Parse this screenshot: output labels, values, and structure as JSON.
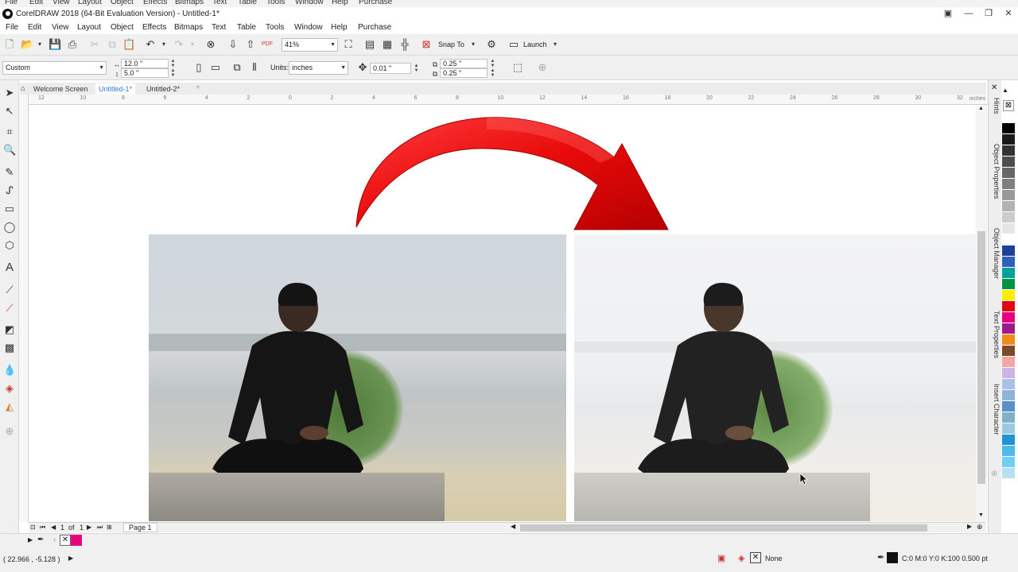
{
  "app": {
    "title": "CorelDRAW 2018 (64-Bit Evaluation Version) - Untitled-1*",
    "ghost_menu": [
      "File",
      "Edit",
      "View",
      "Layout",
      "Object",
      "Effects",
      "Bitmaps",
      "Text",
      "Table",
      "Tools",
      "Window",
      "Help",
      "Purchase"
    ]
  },
  "menubar": [
    "File",
    "Edit",
    "View",
    "Layout",
    "Object",
    "Effects",
    "Bitmaps",
    "Text",
    "Table",
    "Tools",
    "Window",
    "Help",
    "Purchase"
  ],
  "toolbar": {
    "zoom_value": "41%",
    "snap_to_label": "Snap To",
    "launch_label": "Launch",
    "pdf_label": "PDF"
  },
  "property_bar": {
    "page_size": "Custom",
    "width": "12.0 \"",
    "height": "5.0 \"",
    "units_label": "Units:",
    "units_value": "inches",
    "nudge": "0.01 \"",
    "dup_x": "0.25 \"",
    "dup_y": "0.25 \""
  },
  "doc_tabs": [
    {
      "label": "Welcome Screen",
      "active": false
    },
    {
      "label": "Untitled-1*",
      "active": true
    },
    {
      "label": "Untitled-2*",
      "active": false
    }
  ],
  "ruler": {
    "units_label": "inches",
    "h_ticks": [
      "12",
      "10",
      "8",
      "6",
      "4",
      "2",
      "0",
      "2",
      "4",
      "6",
      "8",
      "10",
      "12",
      "14",
      "16",
      "18",
      "20",
      "22",
      "24",
      "26",
      "28",
      "30",
      "32"
    ]
  },
  "right_dock": [
    "Hints",
    "Object Properties",
    "Object Manager",
    "Text Properties",
    "Insert Character"
  ],
  "palette": [
    "#000000",
    "#1a1a1a",
    "#333333",
    "#4d4d4d",
    "#666666",
    "#808080",
    "#999999",
    "#b3b3b3",
    "#cccccc",
    "#e6e6e6",
    "#ffffff",
    "#1f3f9a",
    "#2e5fbf",
    "#00a19a",
    "#009640",
    "#ffed00",
    "#e30613",
    "#e6007e",
    "#9b1b8a",
    "#f08a1d",
    "#7a4a2a",
    "#f4a6a0",
    "#c9b6e4",
    "#a9c1e8",
    "#8fb3d9",
    "#5b8ecb",
    "#7fb2c8",
    "#9cc9e0",
    "#1d95d3",
    "#4fb9e8",
    "#6ed0f6",
    "#b8dff2"
  ],
  "page_nav": {
    "current": "1",
    "of_label": "of",
    "total": "1",
    "page_tab": "Page 1"
  },
  "status": {
    "coords": "( 22.966 , -5.128 )",
    "fill_label": "None",
    "outline_label": "C:0 M:0 Y:0 K:100  0.500 pt"
  },
  "colors": {
    "arrow_red": "#e30b0b",
    "accent_blue": "#3a7bd5",
    "bg_gray": "#f0f0f0"
  }
}
